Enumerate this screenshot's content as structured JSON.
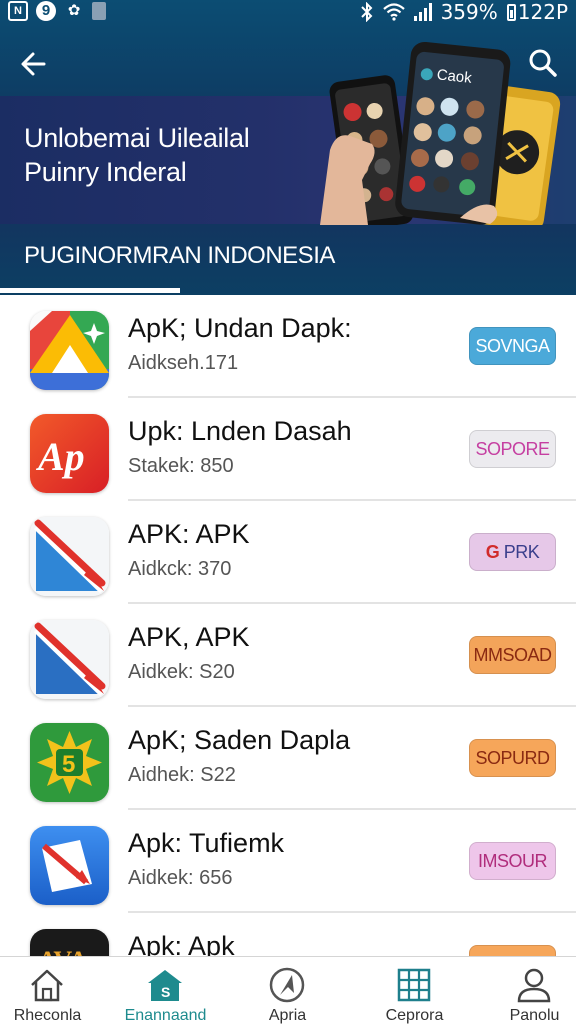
{
  "status_bar": {
    "left_icons": [
      "n-badge-icon",
      "circle-9-icon",
      "puzzle-icon",
      "file-icon"
    ],
    "battery_percent": "359%",
    "time": "122P"
  },
  "header": {
    "banner_title_line1": "Unlobemai Uileailal",
    "banner_title_line2": "Puinry Inderal",
    "phone_screen_text": "Caok",
    "tab_label": "PUGINORMRAN INDONESIA"
  },
  "apps": [
    {
      "name": "ApK; Undan Dapk:",
      "subtitle": "Aidkseh.171",
      "action": "SOVNGA",
      "action_bg": "#4ba9d9",
      "action_fg": "#ffffff",
      "icon": "tent-icon"
    },
    {
      "name": "Upk:  Lnden Dasah",
      "subtitle": "Stakek: 850",
      "action": "SOPORE",
      "action_bg": "#ecebef",
      "action_fg": "#c53fa1",
      "icon": "app-script-icon"
    },
    {
      "name": "APK: APK",
      "subtitle": "Aidkck: 370",
      "action": "PRK",
      "action_bg": "#e6c8e8",
      "action_fg": "#3a3f8c",
      "icon": "arrow-triangle-icon"
    },
    {
      "name": "APK, APK",
      "subtitle": "Aidkek: S20",
      "action": "MMSOAD",
      "action_bg": "#f3a45a",
      "action_fg": "#8a2a12",
      "icon": "arrow-triangle-icon"
    },
    {
      "name": "ApK; Saden Dapla",
      "subtitle": "Aidhek: S22",
      "action": "SOPURD",
      "action_bg": "#f6a65a",
      "action_fg": "#8a2a12",
      "icon": "sun-five-icon"
    },
    {
      "name": "Apk: Tufiemk",
      "subtitle": "Aidkek: 656",
      "action": "IMSOUR",
      "action_bg": "#eec6ea",
      "action_fg": "#b02c7c",
      "icon": "document-arrow-icon"
    },
    {
      "name": "Apk: Apk",
      "subtitle": "",
      "action": "",
      "action_bg": "#f6a65a",
      "action_fg": "#8a2a12",
      "icon": "ava-icon"
    }
  ],
  "icon_text": {
    "app_script": "Ap",
    "sun_digit": "5",
    "ava": "AVA"
  },
  "bottom_nav": [
    {
      "label": "Rheconla",
      "icon": "home-icon",
      "active": false
    },
    {
      "label": "Enannaand",
      "icon": "store-icon",
      "active": true
    },
    {
      "label": "Apria",
      "icon": "compass-icon",
      "active": false
    },
    {
      "label": "Ceprora",
      "icon": "grid-icon",
      "active": false
    },
    {
      "label": "Panolu",
      "icon": "profile-icon",
      "active": false
    }
  ]
}
